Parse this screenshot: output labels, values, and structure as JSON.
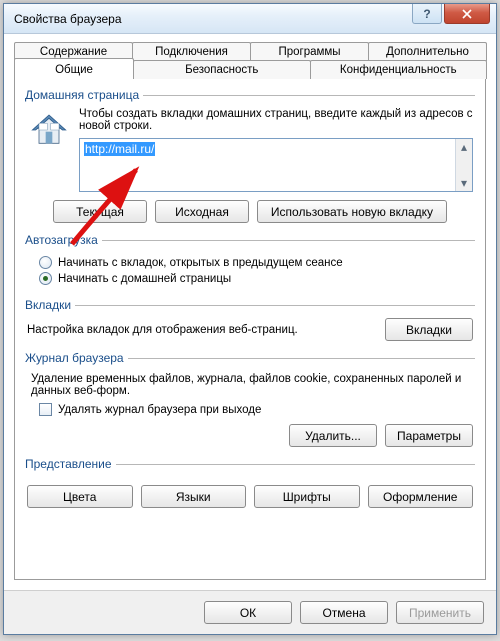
{
  "window": {
    "title": "Свойства браузера"
  },
  "tabs_back": [
    "Содержание",
    "Подключения",
    "Программы",
    "Дополнительно"
  ],
  "tabs_front": [
    "Общие",
    "Безопасность",
    "Конфиденциальность"
  ],
  "active_tab": "Общие",
  "homepage": {
    "legend": "Домашняя страница",
    "text": "Чтобы создать вкладки домашних страниц, введите каждый из адресов с новой строки.",
    "url": "http://mail.ru/",
    "btn_current": "Текущая",
    "btn_default": "Исходная",
    "btn_newtab": "Использовать новую вкладку"
  },
  "autoload": {
    "legend": "Автозагрузка",
    "opt1": "Начинать с вкладок, открытых в предыдущем сеансе",
    "opt2": "Начинать с домашней страницы"
  },
  "tabs_sec": {
    "legend": "Вкладки",
    "text": "Настройка вкладок для отображения веб-страниц.",
    "btn": "Вкладки"
  },
  "history": {
    "legend": "Журнал браузера",
    "text": "Удаление временных файлов, журнала, файлов cookie, сохраненных паролей и данных веб-форм.",
    "check": "Удалять журнал браузера при выходе",
    "btn_delete": "Удалить...",
    "btn_params": "Параметры"
  },
  "appearance": {
    "legend": "Представление",
    "btn_colors": "Цвета",
    "btn_lang": "Языки",
    "btn_fonts": "Шрифты",
    "btn_style": "Оформление"
  },
  "footer": {
    "ok": "ОК",
    "cancel": "Отмена",
    "apply": "Применить"
  }
}
